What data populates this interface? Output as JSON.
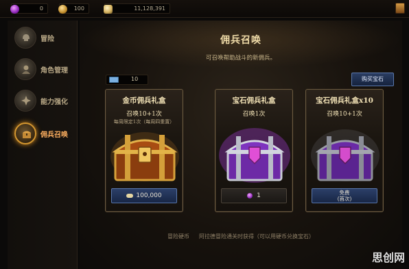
{
  "topbar": {
    "resources": [
      {
        "icon": "gem-icon",
        "value": "0"
      },
      {
        "icon": "gold-coin-icon",
        "value": "100"
      },
      {
        "icon": "coin-pile-icon",
        "value": "11,128,391"
      }
    ],
    "right_icon": "event-icon"
  },
  "sidebar": {
    "items": [
      {
        "label": "冒险",
        "icon": "helmet-icon",
        "active": false
      },
      {
        "label": "角色管理",
        "icon": "character-icon",
        "active": false
      },
      {
        "label": "能力强化",
        "icon": "power-icon",
        "active": false
      },
      {
        "label": "佣兵召唤",
        "icon": "summon-chest-icon",
        "active": true
      }
    ]
  },
  "main": {
    "title": "佣兵召唤",
    "subtitle": "可召唤帮助战斗的新佣兵。",
    "ticket_count": "10",
    "buy_gem_button": "购买宝石",
    "cards": [
      {
        "name": "金币佣兵礼盒",
        "summon": "召唤10+1次",
        "limit": "每周限定1次（每周四重置）",
        "chest": "gold",
        "price_icon": "coin-pile-icon",
        "price": "100,000"
      },
      {
        "name": "宝石佣兵礼盒",
        "summon": "召唤1次",
        "limit": "",
        "chest": "purple",
        "price_icon": "gem-icon",
        "price": "1"
      },
      {
        "name": "宝石佣兵礼盒x10",
        "summon": "召唤10+1次",
        "limit": "",
        "chest": "purple-dark",
        "price_line1": "免费",
        "price_line2": "(首次)"
      }
    ],
    "footer_left": "冒险硬币",
    "footer_right": "阿拉德冒险通关时获得（可以用硬币兑换宝石）"
  },
  "watermark": "思创网",
  "colors": {
    "accent_gold": "#d59730",
    "button_blue": "#2c3f68",
    "gem_purple": "#9630c0"
  }
}
